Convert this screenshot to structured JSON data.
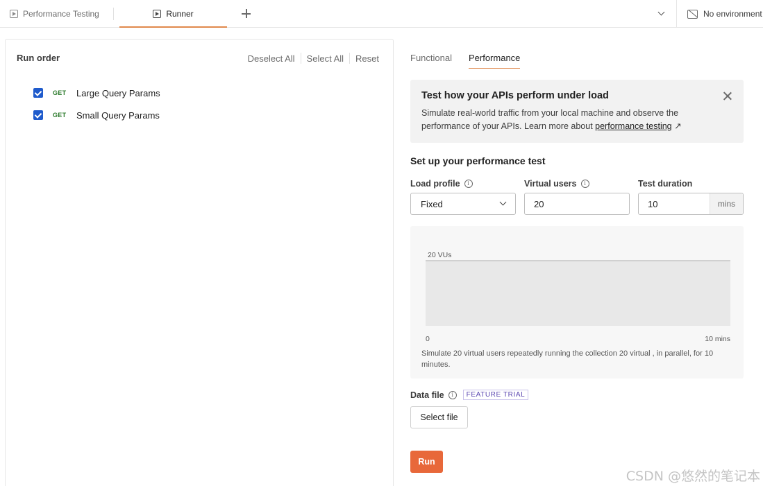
{
  "top_tabs": [
    {
      "label": "Performance Testing",
      "icon": "run-icon",
      "active": false
    },
    {
      "label": "Runner",
      "icon": "run-icon",
      "active": true
    }
  ],
  "environment": {
    "label": "No environment",
    "icon": "no-environment-icon"
  },
  "run_order": {
    "title": "Run order",
    "actions": [
      "Deselect All",
      "Select All",
      "Reset"
    ],
    "requests": [
      {
        "method": "GET",
        "name": "Large Query Params",
        "checked": true
      },
      {
        "method": "GET",
        "name": "Small Query Params",
        "checked": true
      }
    ]
  },
  "right_tabs": [
    {
      "label": "Functional",
      "active": false
    },
    {
      "label": "Performance",
      "active": true
    }
  ],
  "banner": {
    "title": "Test how your APIs perform under load",
    "text": "Simulate real-world traffic from your local machine and observe the performance of your APIs. Learn more about",
    "link": "performance testing",
    "link_suffix": "↗"
  },
  "setup": {
    "title": "Set up your performance test",
    "load_profile": {
      "label": "Load profile",
      "value": "Fixed"
    },
    "virtual_users": {
      "label": "Virtual users",
      "value": "20"
    },
    "test_duration": {
      "label": "Test duration",
      "value": "10",
      "unit": "mins"
    }
  },
  "chart_data": {
    "type": "area",
    "x": [
      0,
      10
    ],
    "y": [
      20,
      20
    ],
    "series_label": "20 VUs",
    "x_start_label": "0",
    "x_end_label": "10 mins",
    "xlim": [
      0,
      10
    ],
    "ylim": [
      0,
      20
    ],
    "fill_color": "#e8e8e8",
    "line_color": "#d0d0d0"
  },
  "chart_description": "Simulate 20 virtual users repeatedly running the collection 20 virtual , in parallel, for 10 minutes.",
  "data_file": {
    "label": "Data file",
    "badge": "FEATURE TRIAL",
    "button": "Select file"
  },
  "run_button": "Run",
  "watermark": "CSDN @悠然的笔记本",
  "colors": {
    "accent": "#e8683a",
    "checkbox": "#1f5bcc",
    "get_method": "#2b7a2b"
  }
}
